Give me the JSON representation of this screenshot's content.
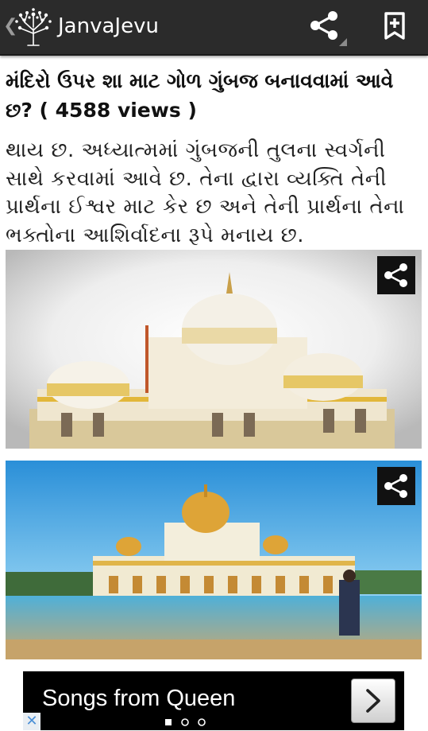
{
  "app": {
    "title": "JanvaJevu",
    "back_glyph": "❮",
    "icons": [
      "tree-logo-icon",
      "share-icon",
      "bookmark-add-icon"
    ]
  },
  "article": {
    "title": "મંદિરો ઉપર શા માટ ગોળ ગુંબજ બનાવવામાં આવે છ? ( 4588 views )",
    "body": "થાય છ. અધ્યાત્મમાં ગુંબજની તુલના સ્વર્ગની સાથે કરવામાં આવે છ. તેના દ્વારા વ્યક્તિ તેની પ્રાર્થના ઈશ્વર માટ કેર છ અને તેની પ્રાર્થના તેના ભક્તોના આશિર્વાદના રૂપે મનાય છ."
  },
  "images": [
    {
      "subject": "white-domed-gurdwara",
      "share_icon": "share-icon"
    },
    {
      "subject": "golden-domed-gurdwara-by-water",
      "share_icon": "share-icon"
    }
  ],
  "ad": {
    "text": "Songs from Queen",
    "arrow_icon": "chevron-right-icon",
    "close_glyph": "✕",
    "page_count": 3,
    "active_page": 1
  }
}
